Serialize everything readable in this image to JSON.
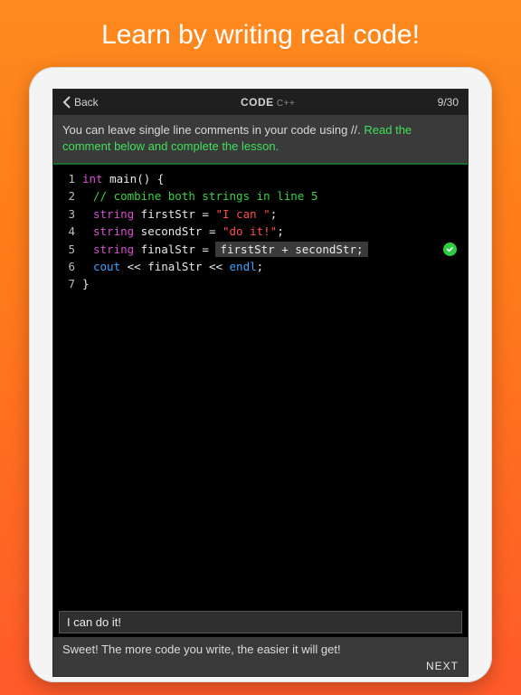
{
  "headline": "Learn by writing real code!",
  "topbar": {
    "back_label": "Back",
    "title_main": "CODE",
    "title_sub": " C++",
    "progress": "9/30"
  },
  "instruction": {
    "text": "You can leave single line comments in your code using //.  ",
    "action": "Read the comment below and complete the lesson."
  },
  "code": {
    "l1": {
      "n": "1",
      "kw": "int",
      "rest": " main() {"
    },
    "l2": {
      "n": "2",
      "comment": "// combine both strings in line 5"
    },
    "l3": {
      "n": "3",
      "kw": "string",
      "ident": " firstStr = ",
      "str": "\"I can \"",
      "tail": ";"
    },
    "l4": {
      "n": "4",
      "kw": "string",
      "ident": " secondStr = ",
      "str": "\"do it!\"",
      "tail": ";"
    },
    "l5": {
      "n": "5",
      "kw": "string",
      "ident": " finalStr = ",
      "input": "firstStr + secondStr;"
    },
    "l6": {
      "n": "6",
      "io": "cout",
      "mid": " << finalStr << ",
      "io2": "endl",
      "tail": ";"
    },
    "l7": {
      "n": "7",
      "rest": "}"
    }
  },
  "output": "I can do it!",
  "footer": {
    "message": "Sweet!  The more code you write, the easier it will get!",
    "next": "NEXT"
  }
}
